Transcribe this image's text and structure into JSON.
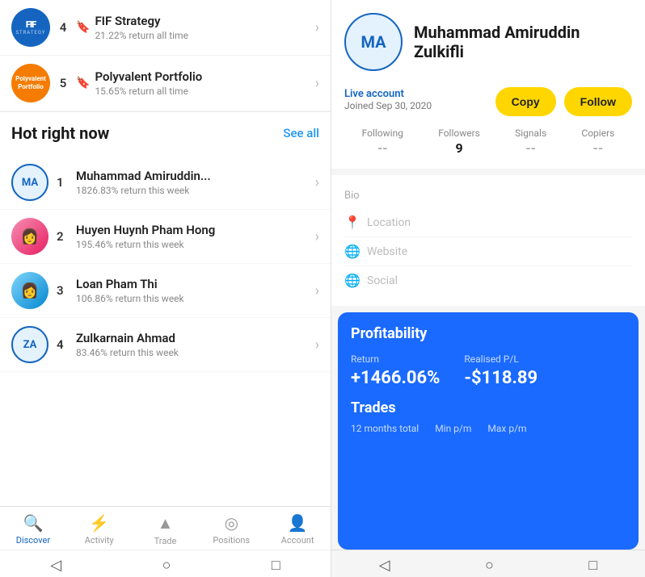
{
  "left": {
    "strategies": [
      {
        "rank": "4",
        "name": "FIF Strategy",
        "return": "21.22% return all time",
        "type": "fif"
      },
      {
        "rank": "5",
        "name": "Polyvalent Portfolio",
        "return": "15.65% return all time",
        "type": "poly"
      }
    ],
    "hot_section": {
      "title": "Hot right now",
      "see_all": "See all"
    },
    "hot_list": [
      {
        "rank": "1",
        "name": "Muhammad Amiruddin...",
        "return": "1826.83% return this week",
        "type": "ma",
        "initials": "MA"
      },
      {
        "rank": "2",
        "name": "Huyen Huynh Pham Hong",
        "return": "195.46% return this week",
        "type": "photo_pink"
      },
      {
        "rank": "3",
        "name": "Loan Pham Thi",
        "return": "106.86% return this week",
        "type": "photo_blue"
      },
      {
        "rank": "4",
        "name": "Zulkarnain Ahmad",
        "return": "83.46% return this week",
        "type": "za",
        "initials": "ZA"
      }
    ],
    "nav": {
      "items": [
        {
          "label": "Discover",
          "icon": "🔍",
          "active": true
        },
        {
          "label": "Activity",
          "icon": "⚡",
          "active": false
        },
        {
          "label": "Trade",
          "icon": "▲",
          "active": false
        },
        {
          "label": "Positions",
          "icon": "⊙",
          "active": false
        },
        {
          "label": "Account",
          "icon": "👤",
          "active": false
        }
      ]
    }
  },
  "right": {
    "profile": {
      "initials": "MA",
      "name": "Muhammad Amiruddin Zulkifli",
      "account_type": "Live account",
      "joined": "Joined Sep 30, 2020",
      "copy_btn": "Copy",
      "follow_btn": "Follow"
    },
    "stats": {
      "following_label": "Following",
      "following_value": "--",
      "followers_label": "Followers",
      "followers_value": "9",
      "signals_label": "Signals",
      "signals_value": "--",
      "copiers_label": "Copiers",
      "copiers_value": "--"
    },
    "bio_label": "Bio",
    "location_label": "Location",
    "website_label": "Website",
    "social_label": "Social",
    "profitability": {
      "title": "Profitability",
      "return_label": "Return",
      "return_value": "+1466.06%",
      "pl_label": "Realised P/L",
      "pl_value": "-$118.89",
      "trades_title": "Trades",
      "trades_period": "12 months total",
      "min_label": "Min p/m",
      "max_label": "Max p/m"
    }
  }
}
